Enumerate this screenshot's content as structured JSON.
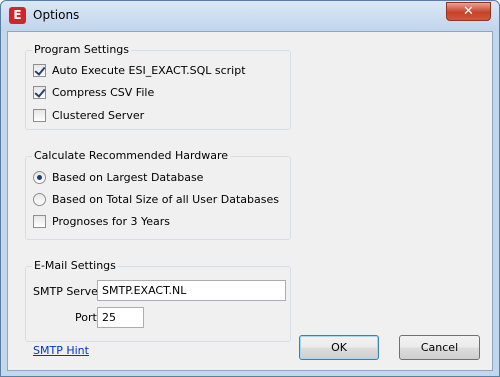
{
  "window": {
    "title": "Options",
    "close_glyph": "✕",
    "app_icon_letter": "E",
    "app_icon_color": "#d3242a"
  },
  "program_settings": {
    "label": "Program Settings",
    "items": [
      {
        "label": "Auto Execute ESI_EXACT.SQL script",
        "checked": true
      },
      {
        "label": "Compress CSV File",
        "checked": true
      },
      {
        "label": "Clustered Server",
        "checked": false
      }
    ]
  },
  "hardware": {
    "label": "Calculate Recommended Hardware",
    "radios": [
      {
        "label": "Based on Largest Database",
        "selected": true
      },
      {
        "label": "Based on Total Size of all User Databases",
        "selected": false
      }
    ],
    "prognoses": {
      "label": "Prognoses for 3 Years",
      "checked": false
    }
  },
  "email": {
    "label": "E-Mail Settings",
    "smtp_server_label": "SMTP Server",
    "smtp_server_value": "SMTP.EXACT.NL",
    "port_label": "Port",
    "port_value": "25"
  },
  "smtp_hint": "SMTP Hint",
  "buttons": {
    "ok": "OK",
    "cancel": "Cancel"
  }
}
